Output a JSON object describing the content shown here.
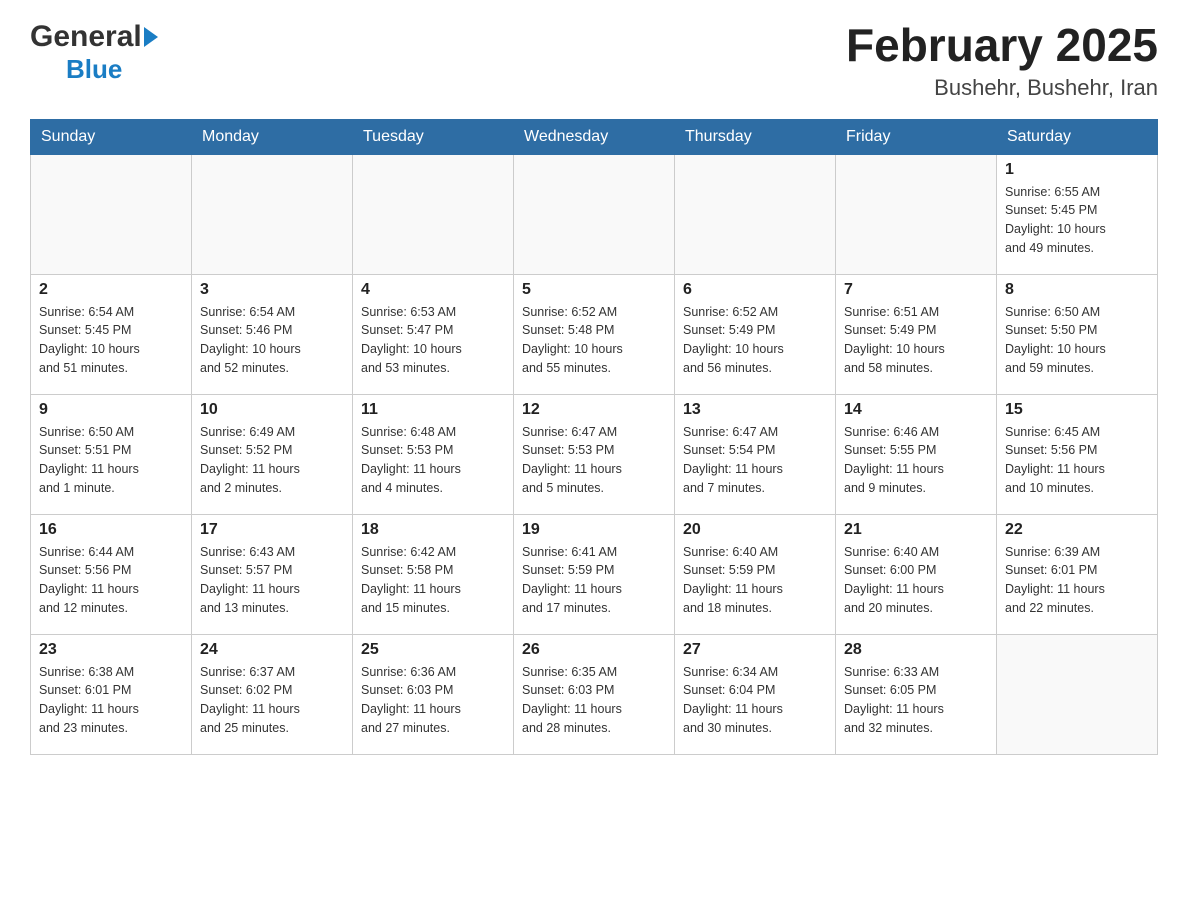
{
  "header": {
    "logo_general": "General",
    "logo_blue": "Blue",
    "month_year": "February 2025",
    "location": "Bushehr, Bushehr, Iran"
  },
  "days_header": [
    "Sunday",
    "Monday",
    "Tuesday",
    "Wednesday",
    "Thursday",
    "Friday",
    "Saturday"
  ],
  "weeks": [
    [
      {
        "day": "",
        "info": ""
      },
      {
        "day": "",
        "info": ""
      },
      {
        "day": "",
        "info": ""
      },
      {
        "day": "",
        "info": ""
      },
      {
        "day": "",
        "info": ""
      },
      {
        "day": "",
        "info": ""
      },
      {
        "day": "1",
        "info": "Sunrise: 6:55 AM\nSunset: 5:45 PM\nDaylight: 10 hours\nand 49 minutes."
      }
    ],
    [
      {
        "day": "2",
        "info": "Sunrise: 6:54 AM\nSunset: 5:45 PM\nDaylight: 10 hours\nand 51 minutes."
      },
      {
        "day": "3",
        "info": "Sunrise: 6:54 AM\nSunset: 5:46 PM\nDaylight: 10 hours\nand 52 minutes."
      },
      {
        "day": "4",
        "info": "Sunrise: 6:53 AM\nSunset: 5:47 PM\nDaylight: 10 hours\nand 53 minutes."
      },
      {
        "day": "5",
        "info": "Sunrise: 6:52 AM\nSunset: 5:48 PM\nDaylight: 10 hours\nand 55 minutes."
      },
      {
        "day": "6",
        "info": "Sunrise: 6:52 AM\nSunset: 5:49 PM\nDaylight: 10 hours\nand 56 minutes."
      },
      {
        "day": "7",
        "info": "Sunrise: 6:51 AM\nSunset: 5:49 PM\nDaylight: 10 hours\nand 58 minutes."
      },
      {
        "day": "8",
        "info": "Sunrise: 6:50 AM\nSunset: 5:50 PM\nDaylight: 10 hours\nand 59 minutes."
      }
    ],
    [
      {
        "day": "9",
        "info": "Sunrise: 6:50 AM\nSunset: 5:51 PM\nDaylight: 11 hours\nand 1 minute."
      },
      {
        "day": "10",
        "info": "Sunrise: 6:49 AM\nSunset: 5:52 PM\nDaylight: 11 hours\nand 2 minutes."
      },
      {
        "day": "11",
        "info": "Sunrise: 6:48 AM\nSunset: 5:53 PM\nDaylight: 11 hours\nand 4 minutes."
      },
      {
        "day": "12",
        "info": "Sunrise: 6:47 AM\nSunset: 5:53 PM\nDaylight: 11 hours\nand 5 minutes."
      },
      {
        "day": "13",
        "info": "Sunrise: 6:47 AM\nSunset: 5:54 PM\nDaylight: 11 hours\nand 7 minutes."
      },
      {
        "day": "14",
        "info": "Sunrise: 6:46 AM\nSunset: 5:55 PM\nDaylight: 11 hours\nand 9 minutes."
      },
      {
        "day": "15",
        "info": "Sunrise: 6:45 AM\nSunset: 5:56 PM\nDaylight: 11 hours\nand 10 minutes."
      }
    ],
    [
      {
        "day": "16",
        "info": "Sunrise: 6:44 AM\nSunset: 5:56 PM\nDaylight: 11 hours\nand 12 minutes."
      },
      {
        "day": "17",
        "info": "Sunrise: 6:43 AM\nSunset: 5:57 PM\nDaylight: 11 hours\nand 13 minutes."
      },
      {
        "day": "18",
        "info": "Sunrise: 6:42 AM\nSunset: 5:58 PM\nDaylight: 11 hours\nand 15 minutes."
      },
      {
        "day": "19",
        "info": "Sunrise: 6:41 AM\nSunset: 5:59 PM\nDaylight: 11 hours\nand 17 minutes."
      },
      {
        "day": "20",
        "info": "Sunrise: 6:40 AM\nSunset: 5:59 PM\nDaylight: 11 hours\nand 18 minutes."
      },
      {
        "day": "21",
        "info": "Sunrise: 6:40 AM\nSunset: 6:00 PM\nDaylight: 11 hours\nand 20 minutes."
      },
      {
        "day": "22",
        "info": "Sunrise: 6:39 AM\nSunset: 6:01 PM\nDaylight: 11 hours\nand 22 minutes."
      }
    ],
    [
      {
        "day": "23",
        "info": "Sunrise: 6:38 AM\nSunset: 6:01 PM\nDaylight: 11 hours\nand 23 minutes."
      },
      {
        "day": "24",
        "info": "Sunrise: 6:37 AM\nSunset: 6:02 PM\nDaylight: 11 hours\nand 25 minutes."
      },
      {
        "day": "25",
        "info": "Sunrise: 6:36 AM\nSunset: 6:03 PM\nDaylight: 11 hours\nand 27 minutes."
      },
      {
        "day": "26",
        "info": "Sunrise: 6:35 AM\nSunset: 6:03 PM\nDaylight: 11 hours\nand 28 minutes."
      },
      {
        "day": "27",
        "info": "Sunrise: 6:34 AM\nSunset: 6:04 PM\nDaylight: 11 hours\nand 30 minutes."
      },
      {
        "day": "28",
        "info": "Sunrise: 6:33 AM\nSunset: 6:05 PM\nDaylight: 11 hours\nand 32 minutes."
      },
      {
        "day": "",
        "info": ""
      }
    ]
  ]
}
